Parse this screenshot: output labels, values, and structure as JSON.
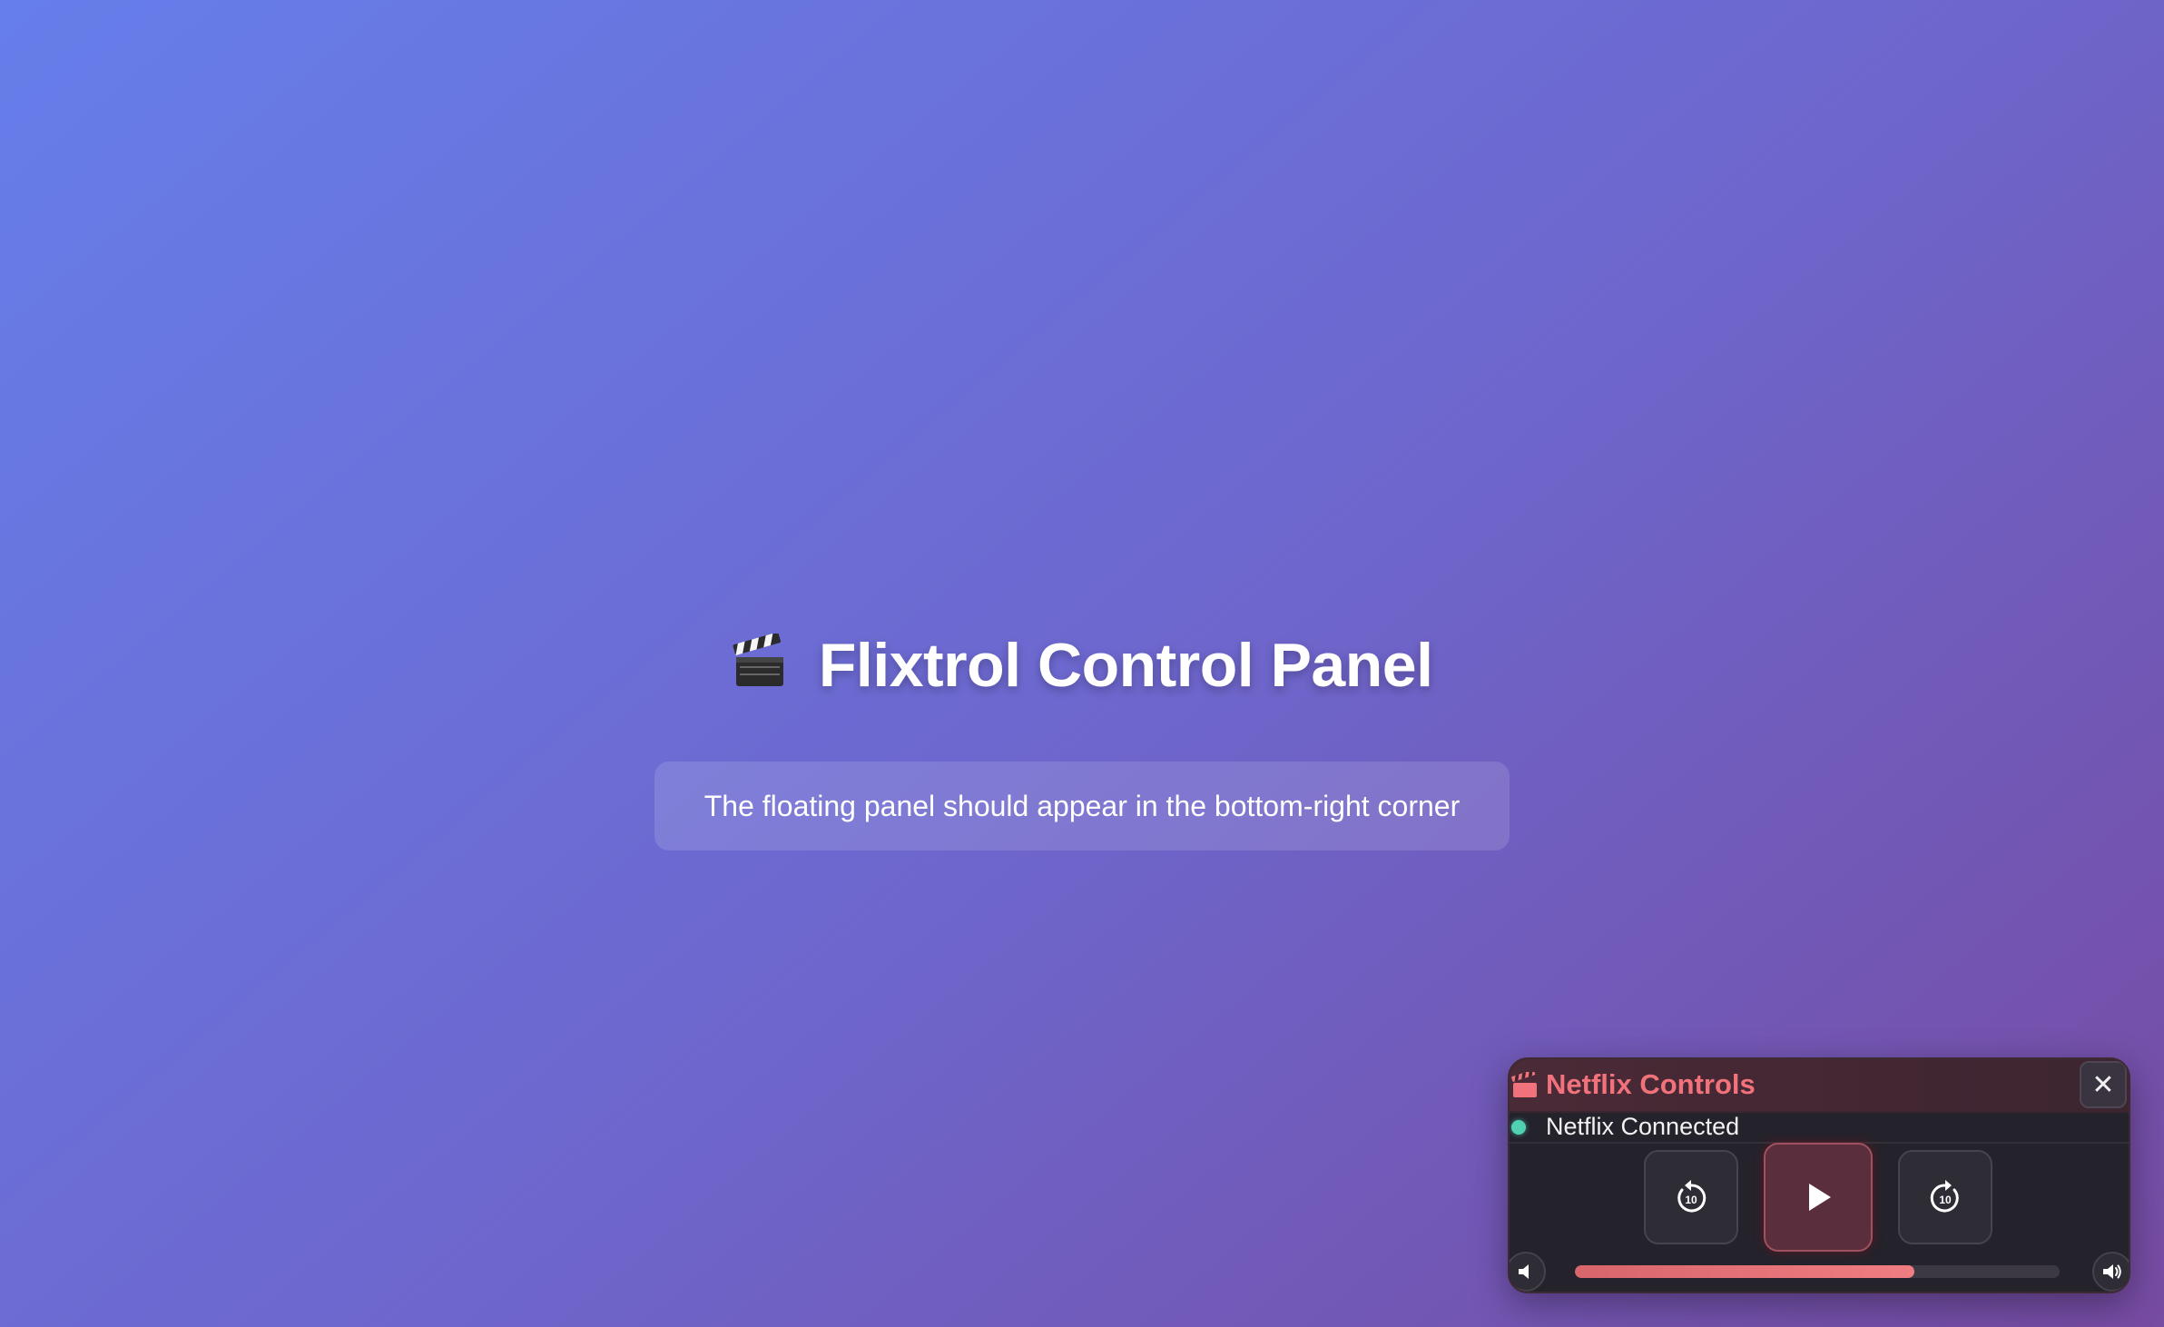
{
  "page": {
    "title": "Flixtrol Control Panel",
    "title_icon": "clapperboard-icon",
    "subtitle": "The floating panel should appear in the bottom-right corner"
  },
  "panel": {
    "title": "Netflix Controls",
    "title_icon": "clapperboard-icon",
    "close_label": "✕",
    "status": {
      "text": "Netflix Connected",
      "color": "#4fd1b2"
    },
    "controls": {
      "rewind_icon": "rewind-10-icon",
      "rewind_seconds": "10",
      "play_icon": "play-icon",
      "forward_icon": "forward-10-icon",
      "forward_seconds": "10"
    },
    "volume": {
      "level_percent": 70,
      "low_icon": "volume-low-icon",
      "high_icon": "volume-high-icon"
    },
    "accent_color": "#f2727c"
  }
}
